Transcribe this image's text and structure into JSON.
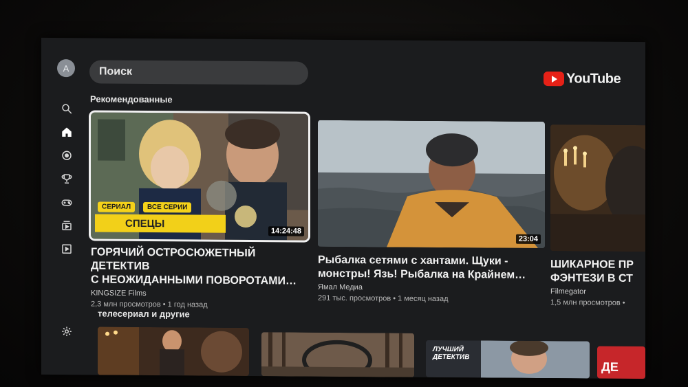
{
  "profile": {
    "initial": "A"
  },
  "search": {
    "label": "Поиск"
  },
  "brand": {
    "name": "YouTube",
    "color": "#e62117"
  },
  "sidebar": {
    "items": [
      {
        "icon": "search-icon"
      },
      {
        "icon": "home-icon"
      },
      {
        "icon": "shorts-icon"
      },
      {
        "icon": "trophy-icon"
      },
      {
        "icon": "gaming-icon"
      },
      {
        "icon": "subscriptions-icon"
      },
      {
        "icon": "library-icon"
      },
      {
        "icon": "settings-icon"
      }
    ]
  },
  "sections": {
    "recommended": "Рекомендованные",
    "second": "телесериал и другие"
  },
  "videos": [
    {
      "title": "ГОРЯЧИЙ ОСТРОСЮЖЕТНЫЙ ДЕТЕКТИВ\nС НЕОЖИДАННЫМИ ПОВОРОТАМИ…",
      "channel": "KINGSIZE Films",
      "meta": "2,3 млн просмотров • 1 год назад",
      "duration": "14:24:48",
      "tag1": "СЕРИАЛ",
      "tag2": "ВСЕ СЕРИИ",
      "banner": "СПЕЦЫ"
    },
    {
      "title": "Рыбалка сетями с хантами. Щуки -\nмонстры! Язь! Рыбалка на Крайнем…",
      "channel": "Ямал Медиа",
      "meta": "291 тыс. просмотров • 1 месяц назад",
      "duration": "23:04"
    },
    {
      "title": "ШИКАРНОЕ ПР\nФЭНТЕЗИ В СТ",
      "channel": "Filmegator",
      "meta": "1,5 млн просмотров •"
    }
  ],
  "row2": {
    "tile3_text": "ЛУЧШИЙ\nДЕТЕКТИВ",
    "tile4_text": "ДЕ"
  }
}
